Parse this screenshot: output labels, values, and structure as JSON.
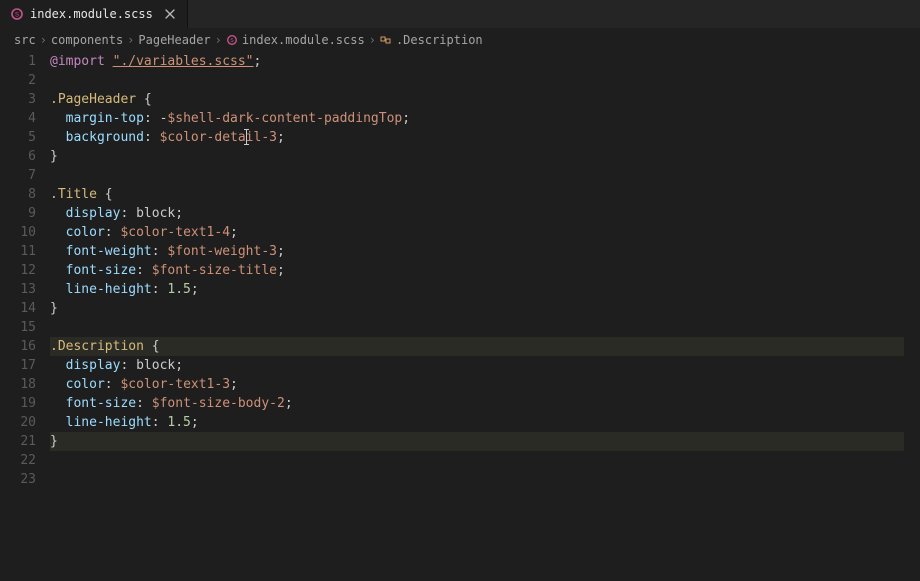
{
  "tab": {
    "filename": "index.module.scss",
    "icon": "scss-file-icon"
  },
  "breadcrumb": {
    "items": [
      {
        "label": "src"
      },
      {
        "label": "components"
      },
      {
        "label": "PageHeader"
      },
      {
        "label": "index.module.scss",
        "icon": "scss-file-icon"
      },
      {
        "label": ".Description",
        "icon": "symbol-class-icon"
      }
    ]
  },
  "lines": [
    {
      "n": 1,
      "tokens": [
        [
          "at",
          "@import"
        ],
        [
          "plain",
          " "
        ],
        [
          "str",
          "\"./variables.scss\""
        ],
        [
          "punc",
          ";"
        ]
      ]
    },
    {
      "n": 2,
      "tokens": []
    },
    {
      "n": 3,
      "tokens": [
        [
          "sel",
          ".PageHeader"
        ],
        [
          "plain",
          " "
        ],
        [
          "punc",
          "{"
        ]
      ]
    },
    {
      "n": 4,
      "tokens": [
        [
          "plain",
          "  "
        ],
        [
          "prop",
          "margin-top"
        ],
        [
          "punc",
          ":"
        ],
        [
          "plain",
          " "
        ],
        [
          "plain",
          "-"
        ],
        [
          "var",
          "$shell-dark-content-paddingTop"
        ],
        [
          "punc",
          ";"
        ]
      ]
    },
    {
      "n": 5,
      "tokens": [
        [
          "plain",
          "  "
        ],
        [
          "prop",
          "background"
        ],
        [
          "punc",
          ":"
        ],
        [
          "plain",
          " "
        ],
        [
          "var",
          "$color-detail-3"
        ],
        [
          "punc",
          ";"
        ]
      ]
    },
    {
      "n": 6,
      "tokens": [
        [
          "punc",
          "}"
        ]
      ]
    },
    {
      "n": 7,
      "tokens": []
    },
    {
      "n": 8,
      "tokens": [
        [
          "sel",
          ".Title"
        ],
        [
          "plain",
          " "
        ],
        [
          "punc",
          "{"
        ]
      ]
    },
    {
      "n": 9,
      "tokens": [
        [
          "plain",
          "  "
        ],
        [
          "prop",
          "display"
        ],
        [
          "punc",
          ":"
        ],
        [
          "plain",
          " "
        ],
        [
          "plain",
          "block"
        ],
        [
          "punc",
          ";"
        ]
      ]
    },
    {
      "n": 10,
      "tokens": [
        [
          "plain",
          "  "
        ],
        [
          "prop",
          "color"
        ],
        [
          "punc",
          ":"
        ],
        [
          "plain",
          " "
        ],
        [
          "var",
          "$color-text1-4"
        ],
        [
          "punc",
          ";"
        ]
      ]
    },
    {
      "n": 11,
      "tokens": [
        [
          "plain",
          "  "
        ],
        [
          "prop",
          "font-weight"
        ],
        [
          "punc",
          ":"
        ],
        [
          "plain",
          " "
        ],
        [
          "var",
          "$font-weight-3"
        ],
        [
          "punc",
          ";"
        ]
      ]
    },
    {
      "n": 12,
      "tokens": [
        [
          "plain",
          "  "
        ],
        [
          "prop",
          "font-size"
        ],
        [
          "punc",
          ":"
        ],
        [
          "plain",
          " "
        ],
        [
          "var",
          "$font-size-title"
        ],
        [
          "punc",
          ";"
        ]
      ]
    },
    {
      "n": 13,
      "tokens": [
        [
          "plain",
          "  "
        ],
        [
          "prop",
          "line-height"
        ],
        [
          "punc",
          ":"
        ],
        [
          "plain",
          " "
        ],
        [
          "num",
          "1.5"
        ],
        [
          "punc",
          ";"
        ]
      ]
    },
    {
      "n": 14,
      "tokens": [
        [
          "punc",
          "}"
        ]
      ]
    },
    {
      "n": 15,
      "tokens": []
    },
    {
      "n": 16,
      "hl": true,
      "tokens": [
        [
          "sel",
          ".Description"
        ],
        [
          "plain",
          " "
        ],
        [
          "punc",
          "{"
        ]
      ]
    },
    {
      "n": 17,
      "tokens": [
        [
          "plain",
          "  "
        ],
        [
          "prop",
          "display"
        ],
        [
          "punc",
          ":"
        ],
        [
          "plain",
          " "
        ],
        [
          "plain",
          "block"
        ],
        [
          "punc",
          ";"
        ]
      ]
    },
    {
      "n": 18,
      "tokens": [
        [
          "plain",
          "  "
        ],
        [
          "prop",
          "color"
        ],
        [
          "punc",
          ":"
        ],
        [
          "plain",
          " "
        ],
        [
          "var",
          "$color-text1-3"
        ],
        [
          "punc",
          ";"
        ]
      ]
    },
    {
      "n": 19,
      "tokens": [
        [
          "plain",
          "  "
        ],
        [
          "prop",
          "font-size"
        ],
        [
          "punc",
          ":"
        ],
        [
          "plain",
          " "
        ],
        [
          "var",
          "$font-size-body-2"
        ],
        [
          "punc",
          ";"
        ]
      ]
    },
    {
      "n": 20,
      "tokens": [
        [
          "plain",
          "  "
        ],
        [
          "prop",
          "line-height"
        ],
        [
          "punc",
          ":"
        ],
        [
          "plain",
          " "
        ],
        [
          "num",
          "1.5"
        ],
        [
          "punc",
          ";"
        ]
      ]
    },
    {
      "n": 21,
      "hl": true,
      "tokens": [
        [
          "punc",
          "}"
        ]
      ]
    },
    {
      "n": 22,
      "tokens": []
    },
    {
      "n": 23,
      "tokens": []
    }
  ],
  "cursor": {
    "line": 5,
    "colPx": 196
  }
}
